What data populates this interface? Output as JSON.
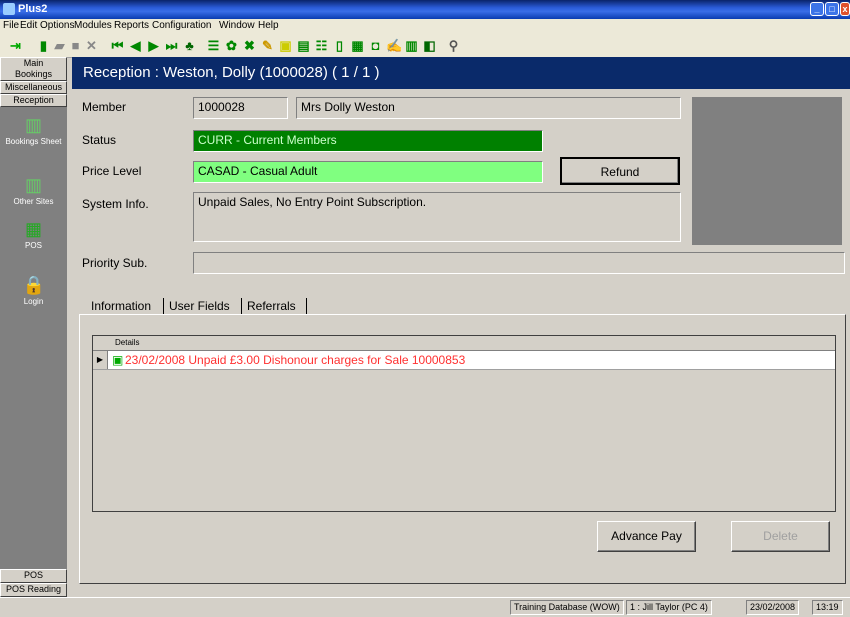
{
  "window": {
    "title": "Plus2"
  },
  "menu": [
    "File",
    "Edit",
    "Options",
    "Modules",
    "Reports",
    "Configuration",
    "Window",
    "Help"
  ],
  "toolbar_icons": [
    "exit-icon",
    "new-icon",
    "open-icon",
    "stop-icon",
    "delete-icon",
    "first-record-icon",
    "previous-record-icon",
    "next-record-icon",
    "last-record-icon",
    "find-icon",
    "members-icon",
    "bookings-icon",
    "classes-icon",
    "tools-icon",
    "calendar-icon",
    "chart-icon",
    "list-icon",
    "document-icon",
    "pos-icon",
    "card-icon",
    "edit-icon",
    "graph-icon",
    "report-icon",
    "link-icon"
  ],
  "nav": {
    "main": "Main",
    "bookings": "Bookings",
    "miscellaneous": "Miscellaneous",
    "reception": "Reception",
    "bookings_sheet": "Bookings Sheet",
    "other_sites": "Other Sites",
    "pos": "POS",
    "login": "Login",
    "pos_bottom": "POS",
    "pos_reading": "POS Reading"
  },
  "header": {
    "title": "Reception : Weston, Dolly (1000028)  ( 1 / 1 )"
  },
  "form": {
    "member_label": "Member",
    "member_id": "1000028",
    "member_name": "Mrs Dolly Weston",
    "status_label": "Status",
    "status_value": "CURR - Current Members",
    "price_label": "Price Level",
    "price_value": "CASAD - Casual Adult",
    "refund_button": "Refund",
    "sysinfo_label": "System Info.",
    "sysinfo_value": "Unpaid Sales, No Entry Point Subscription.",
    "priority_label": "Priority Sub.",
    "priority_value": ""
  },
  "tabs": [
    "Information",
    "User Fields",
    "Referrals"
  ],
  "grid": {
    "column": "Details",
    "rows": [
      "23/02/2008 Unpaid £3.00 Dishonour charges for Sale  10000853"
    ]
  },
  "buttons": {
    "advance_pay": "Advance Pay",
    "delete": "Delete"
  },
  "statusbar": {
    "database": "Training Database (WOW)",
    "user": "1 : Jill Taylor (PC 4)",
    "date": "23/02/2008",
    "time": "13:19"
  },
  "colors": {
    "header_bg": "#0a2a6a",
    "status_bg": "#008000",
    "price_bg": "#80ff80",
    "row_text": "#ff3030"
  }
}
